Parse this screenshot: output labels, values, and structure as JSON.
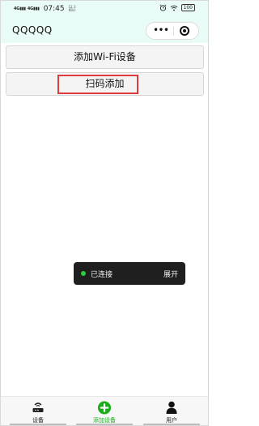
{
  "status_bar": {
    "signal1": "4G",
    "signal2": "4G",
    "time": "07:45",
    "speed": "12.3 KB/s",
    "battery": "100"
  },
  "title_bar": {
    "title": "QQQQQ",
    "menu_glyph": "•••"
  },
  "buttons": {
    "add_wifi": "添加Wi-Fi设备",
    "scan_add": "扫码添加"
  },
  "toast": {
    "status": "已连接",
    "expand": "展开",
    "status_color": "#2ecc40"
  },
  "tabbar": {
    "items": [
      {
        "label": "设备",
        "icon": "router-icon"
      },
      {
        "label": "添加设备",
        "icon": "plus-circle-icon"
      },
      {
        "label": "用户",
        "icon": "user-icon"
      }
    ],
    "active_color": "#1aad19"
  },
  "theme": {
    "header_bg": "#e9fbf6",
    "highlight_color": "#e03a3a"
  }
}
